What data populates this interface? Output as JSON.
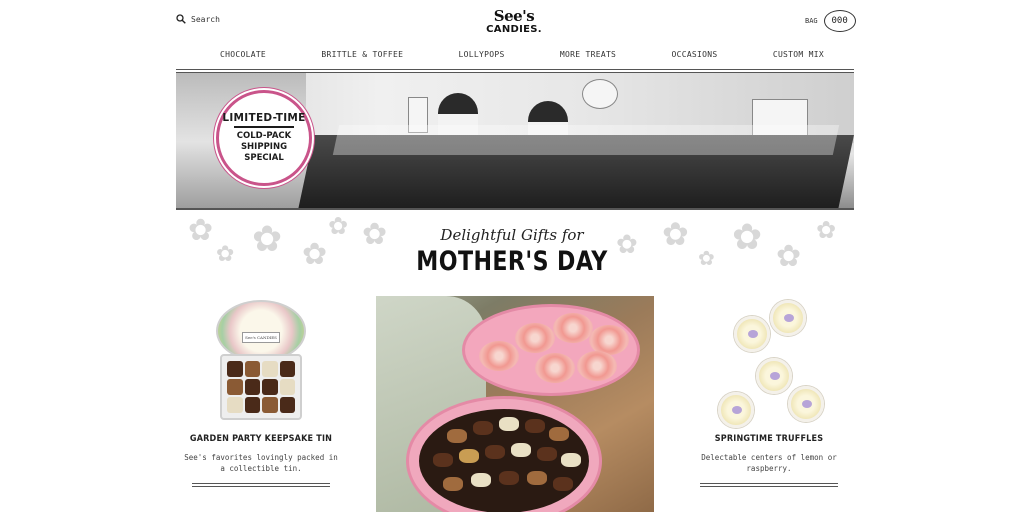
{
  "header": {
    "search_label": "Search",
    "logo_line1": "See's",
    "logo_line2": "CANDIES.",
    "bag_label": "BAG",
    "bag_count": "000"
  },
  "nav": {
    "items": [
      "CHOCOLATE",
      "BRITTLE & TOFFEE",
      "LOLLYPOPS",
      "MORE TREATS",
      "OCCASIONS",
      "CUSTOM MIX"
    ]
  },
  "banner": {
    "badge_line1": "LIMITED-TIME",
    "badge_line2": "COLD-PACK",
    "badge_line3": "SHIPPING",
    "badge_line4": "SPECIAL"
  },
  "section": {
    "script_title": "Delightful Gifts for",
    "main_title": "MOTHER'S DAY"
  },
  "products": [
    {
      "name": "GARDEN PARTY KEEPSAKE TIN",
      "desc_line1": "See's favorites lovingly packed in",
      "desc_line2": "a collectible tin.",
      "tin_label": "See's CANDIES"
    },
    {
      "name": "SPRINGTIME TRUFFLES",
      "desc_line1": "Delectable centers of lemon or",
      "desc_line2": "raspberry."
    }
  ],
  "colors": {
    "badge_border": "#c9548a",
    "box_pink": "#f3a7bd",
    "text_dark": "#222222"
  }
}
